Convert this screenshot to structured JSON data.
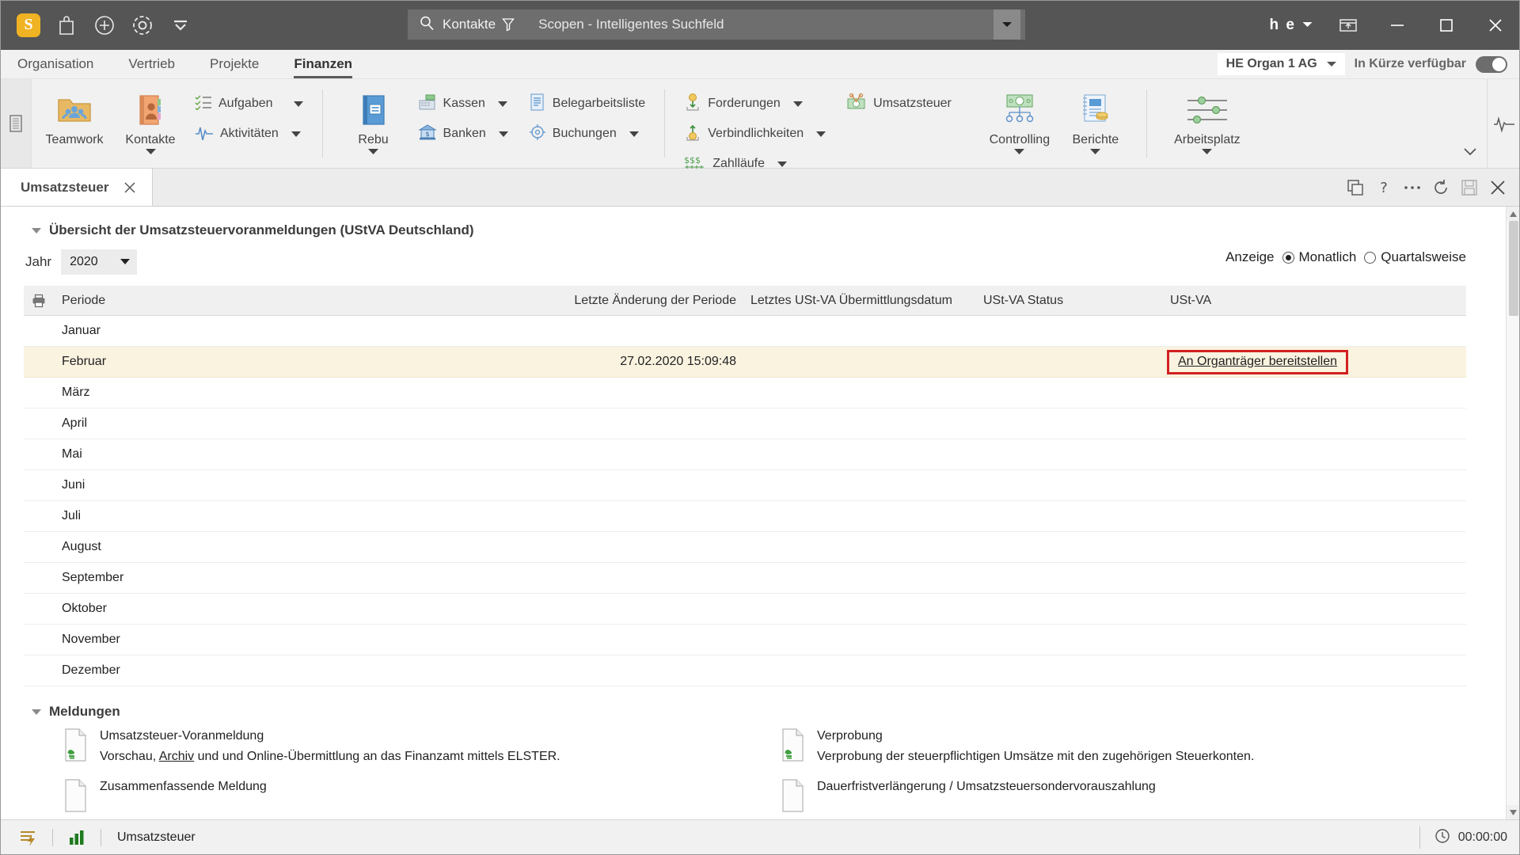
{
  "titlebar": {
    "logo_letter": "S",
    "icons": [
      "bag-icon",
      "plus-circle-icon",
      "target-icon",
      "chevron-collapse-icon"
    ],
    "search": {
      "scope_label": "Kontakte",
      "placeholder": "Scopen - Intelligentes Suchfeld"
    },
    "user_initials": "h e",
    "window_buttons": [
      "restore-window-icon",
      "minimize-icon",
      "maximize-icon",
      "close-icon"
    ]
  },
  "menubar": {
    "items": [
      {
        "label": "Organisation",
        "active": false
      },
      {
        "label": "Vertrieb",
        "active": false
      },
      {
        "label": "Projekte",
        "active": false
      },
      {
        "label": "Finanzen",
        "active": true
      }
    ],
    "org_selector": "HE Organ 1 AG",
    "soon_label": "In Kürze verfügbar",
    "toggle_on": true
  },
  "ribbon": {
    "group1": [
      {
        "label": "Teamwork",
        "icon": "teamwork-folder-icon",
        "has_caret": false
      },
      {
        "label": "Kontakte",
        "icon": "contacts-book-icon",
        "has_caret": true
      }
    ],
    "group1_small": [
      {
        "label": "Aufgaben",
        "icon": "tasks-icon",
        "has_caret": true
      },
      {
        "label": "Aktivitäten",
        "icon": "activities-pulse-icon",
        "has_caret": true
      }
    ],
    "group2": [
      {
        "label": "Rebu",
        "icon": "ledger-book-icon",
        "has_caret": true
      }
    ],
    "group2_small": [
      {
        "label": "Kassen",
        "icon": "cash-register-icon",
        "has_caret": true
      },
      {
        "label": "Banken",
        "icon": "bank-icon",
        "has_caret": true
      }
    ],
    "group3_small": [
      {
        "label": "Belegarbeitsliste",
        "icon": "document-list-icon",
        "has_caret": false
      },
      {
        "label": "Buchungen",
        "icon": "target-bookings-icon",
        "has_caret": true
      }
    ],
    "group4_small": [
      {
        "label": "Forderungen",
        "icon": "receivables-icon",
        "has_caret": true
      },
      {
        "label": "Verbindlichkeiten",
        "icon": "payables-icon",
        "has_caret": true
      },
      {
        "label": "Zahlläufe",
        "icon": "payment-runs-icon",
        "has_caret": true
      }
    ],
    "group5_small": [
      {
        "label": "Umsatzsteuer",
        "icon": "vat-scissors-money-icon",
        "has_caret": false
      }
    ],
    "group6": [
      {
        "label": "Controlling",
        "icon": "controlling-icon",
        "has_caret": true
      },
      {
        "label": "Berichte",
        "icon": "reports-icon",
        "has_caret": true
      }
    ],
    "group7": [
      {
        "label": "Arbeitsplatz",
        "icon": "workplace-sliders-icon",
        "has_caret": true
      }
    ]
  },
  "tabstrip": {
    "tab_label": "Umsatzsteuer",
    "tools": [
      "duplicate-icon",
      "help-icon",
      "more-options-icon",
      "refresh-icon",
      "save-icon",
      "close-icon"
    ]
  },
  "content": {
    "section_title": "Übersicht der Umsatzsteuervoranmeldungen (UStVA Deutschland)",
    "year_label": "Jahr",
    "year_value": "2020",
    "anzeige_label": "Anzeige",
    "display_options": [
      {
        "label": "Monatlich",
        "selected": true
      },
      {
        "label": "Quartalsweise",
        "selected": false
      }
    ],
    "table": {
      "columns": [
        "Periode",
        "Letzte Änderung der Periode",
        "Letztes USt-VA Übermittlungsdatum",
        "USt-VA Status",
        "USt-VA"
      ],
      "rows": [
        {
          "periode": "Januar",
          "change": "",
          "sent": "",
          "status": "",
          "ustva": "",
          "selected": false
        },
        {
          "periode": "Februar",
          "change": "27.02.2020 15:09:48",
          "sent": "",
          "status": "",
          "ustva": "An Organträger bereitstellen",
          "selected": true
        },
        {
          "periode": "März",
          "change": "",
          "sent": "",
          "status": "",
          "ustva": "",
          "selected": false
        },
        {
          "periode": "April",
          "change": "",
          "sent": "",
          "status": "",
          "ustva": "",
          "selected": false
        },
        {
          "periode": "Mai",
          "change": "",
          "sent": "",
          "status": "",
          "ustva": "",
          "selected": false
        },
        {
          "periode": "Juni",
          "change": "",
          "sent": "",
          "status": "",
          "ustva": "",
          "selected": false
        },
        {
          "periode": "Juli",
          "change": "",
          "sent": "",
          "status": "",
          "ustva": "",
          "selected": false
        },
        {
          "periode": "August",
          "change": "",
          "sent": "",
          "status": "",
          "ustva": "",
          "selected": false
        },
        {
          "periode": "September",
          "change": "",
          "sent": "",
          "status": "",
          "ustva": "",
          "selected": false
        },
        {
          "periode": "Oktober",
          "change": "",
          "sent": "",
          "status": "",
          "ustva": "",
          "selected": false
        },
        {
          "periode": "November",
          "change": "",
          "sent": "",
          "status": "",
          "ustva": "",
          "selected": false
        },
        {
          "periode": "Dezember",
          "change": "",
          "sent": "",
          "status": "",
          "ustva": "",
          "selected": false
        }
      ]
    },
    "meldungen": {
      "title": "Meldungen",
      "items": [
        {
          "title": "Umsatzsteuer-Voranmeldung",
          "desc_before": "Vorschau, ",
          "desc_link": "Archiv",
          "desc_after": " und und Online-Übermittlung an das Finanzamt mittels ELSTER."
        },
        {
          "title": "Verprobung",
          "desc_before": "Verprobung der steuerpflichtigen Umsätze mit den zugehörigen Steuerkonten.",
          "desc_link": "",
          "desc_after": ""
        },
        {
          "title": "Zusammenfassende Meldung",
          "desc_before": "",
          "desc_link": "",
          "desc_after": ""
        },
        {
          "title": "Dauerfristverlängerung / Umsatzsteuersondervorauszahlung",
          "desc_before": "",
          "desc_link": "",
          "desc_after": ""
        }
      ]
    }
  },
  "statusbar": {
    "left_icons": [
      "lightning-list-icon",
      "bar-chart-icon"
    ],
    "label": "Umsatzsteuer",
    "timer_icon": "clock-icon",
    "timer": "00:00:00"
  },
  "colors": {
    "titlebar_bg": "#555555",
    "accent_orange": "#f0b323",
    "highlight_row": "#faf3e0",
    "highlight_border": "#d32020"
  }
}
